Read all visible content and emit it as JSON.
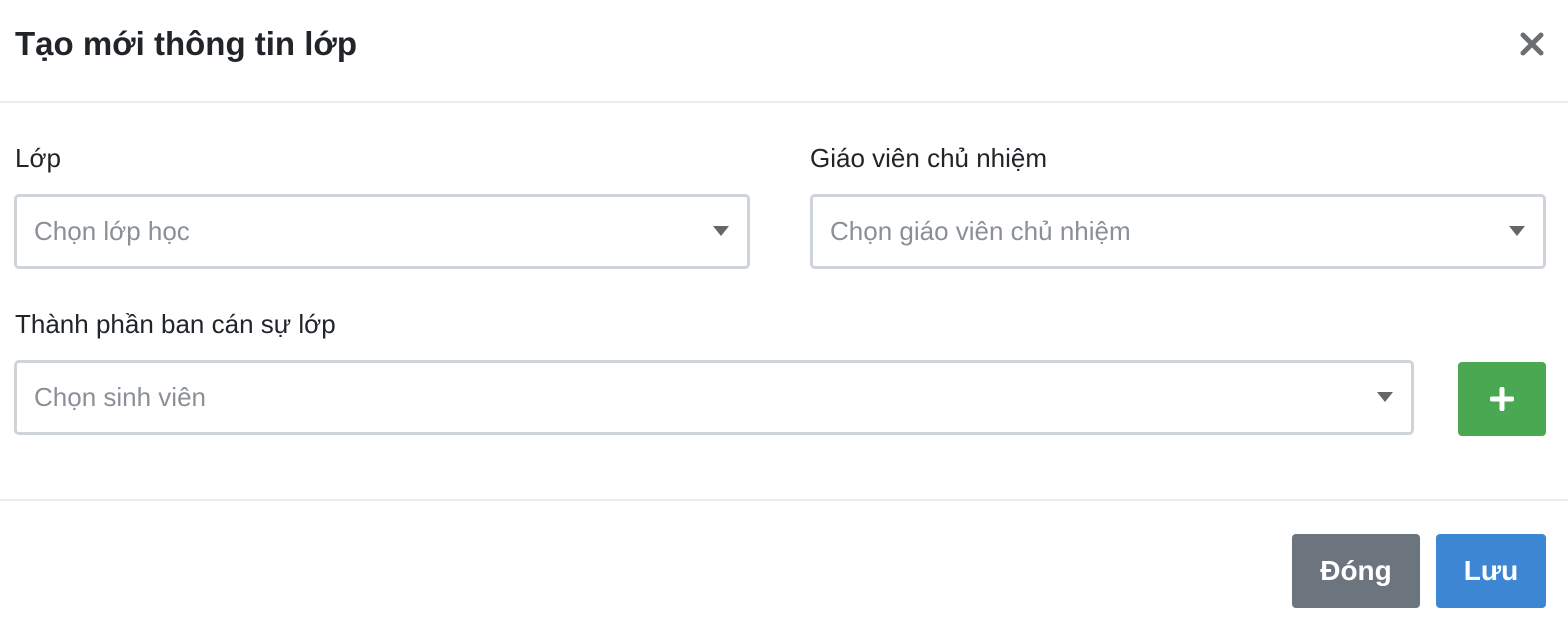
{
  "modal": {
    "title": "Tạo mới thông tin lớp",
    "close_icon": "close-icon"
  },
  "form": {
    "class": {
      "label": "Lớp",
      "placeholder": "Chọn lớp học"
    },
    "homeroom_teacher": {
      "label": "Giáo viên chủ nhiệm",
      "placeholder": "Chọn giáo viên chủ nhiệm"
    },
    "class_committee": {
      "label": "Thành phần ban cán sự lớp",
      "placeholder": "Chọn sinh viên",
      "add_icon": "plus-icon"
    }
  },
  "footer": {
    "close_label": "Đóng",
    "save_label": "Lưu"
  },
  "colors": {
    "add_button": "#4aa852",
    "close_button": "#6c757d",
    "save_button": "#3d86d4"
  }
}
